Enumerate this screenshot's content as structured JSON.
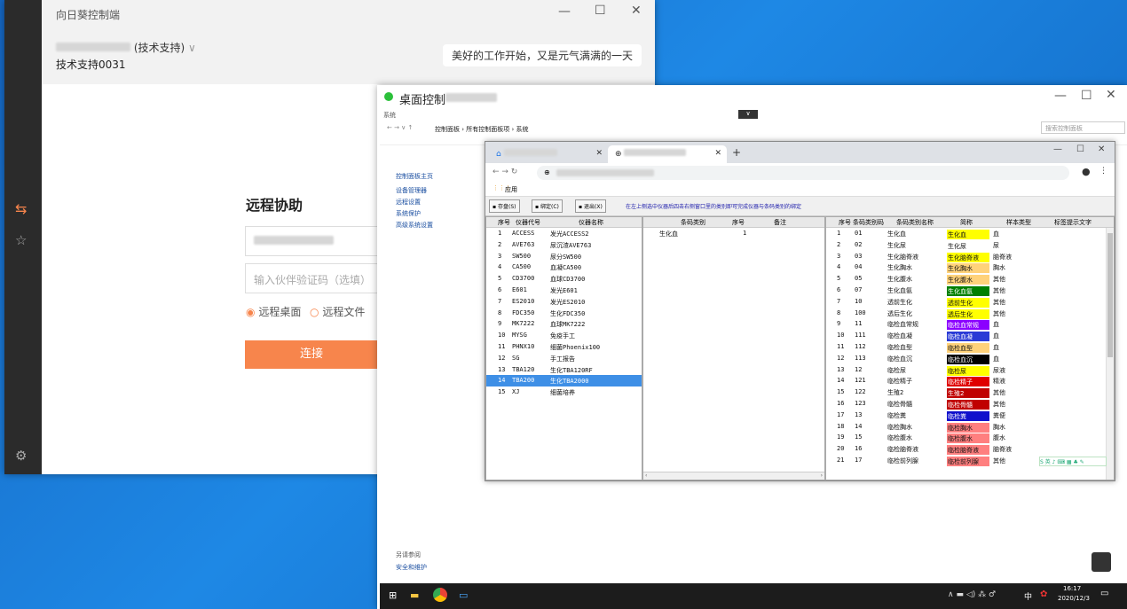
{
  "sunflower": {
    "title": "向日葵控制端",
    "user_role": "(技术支持)",
    "user_name": "技术支持0031",
    "greeting": "美好的工作开始，又是元气满满的一天",
    "heading": "远程协助",
    "code_placeholder": "输入伙伴验证码（选填）",
    "radio_desktop": "远程桌面",
    "radio_file": "远程文件",
    "connect_label": "连接"
  },
  "remote": {
    "title": "桌面控制",
    "cp_breadcrumb": "控制面板 › 所有控制面板项 › 系统",
    "cp_search": "搜索控制面板",
    "cp_window_label": "系统",
    "cp_home": "控制面板主页",
    "cp_links": [
      "设备管理器",
      "远程设置",
      "系统保护",
      "高级系统设置"
    ],
    "cp_see_also": "另请参阅",
    "cp_security": "安全和维护",
    "clock_time": "16:17",
    "clock_date": "2020/12/3",
    "ime": "中"
  },
  "chrome": {
    "bookmark": "应用",
    "toolbar": {
      "save": "存盘(S)",
      "bind": "绑定(C)",
      "exit": "退出(X)",
      "hint": "在左上侧选中仪器后四击右侧窗口里的类别即可完成仪器与条码类别的绑定"
    },
    "instruments_headers": [
      "序号",
      "仪器代号",
      "仪器名称"
    ],
    "instruments": [
      [
        "1",
        "ACCESS",
        "发光ACCESS2"
      ],
      [
        "2",
        "AVE763",
        "尿沉渣AVE763"
      ],
      [
        "3",
        "SW500",
        "尿分SW500"
      ],
      [
        "4",
        "CA500",
        "血凝CA500"
      ],
      [
        "5",
        "CD3700",
        "血球CD3700"
      ],
      [
        "6",
        "E601",
        "发光E601"
      ],
      [
        "7",
        "ES2010",
        "发光ES2010"
      ],
      [
        "8",
        "FDC350",
        "生化FDC350"
      ],
      [
        "9",
        "MK7222",
        "血球MK7222"
      ],
      [
        "10",
        "MYSG",
        "免疫手工"
      ],
      [
        "11",
        "PHNX10",
        "细菌Phoenix100"
      ],
      [
        "12",
        "SG",
        "手工报告"
      ],
      [
        "13",
        "TBA120",
        "生化TBA120RF"
      ],
      [
        "14",
        "TBA200",
        "生化TBA2000"
      ],
      [
        "15",
        "XJ",
        "细菌培养"
      ]
    ],
    "mid_headers": [
      "条码类别",
      "序号",
      "备注"
    ],
    "mid_rows": [
      [
        "生化血",
        "1",
        ""
      ]
    ],
    "right_headers": [
      "序号",
      "条码类别码",
      "条码类别名称",
      "简称",
      "样本类型",
      "标签提示文字"
    ],
    "right_rows": [
      [
        "1",
        "01",
        "生化血",
        "生化血",
        "血",
        "#ffff00"
      ],
      [
        "2",
        "02",
        "生化尿",
        "生化尿",
        "尿",
        "#ffffff"
      ],
      [
        "3",
        "03",
        "生化脑脊液",
        "生化脑脊液",
        "脑脊液",
        "#ffff00"
      ],
      [
        "4",
        "04",
        "生化胸水",
        "生化胸水",
        "胸水",
        "#ffd27a"
      ],
      [
        "5",
        "05",
        "生化腹水",
        "生化腹水",
        "其他",
        "#ffd27a"
      ],
      [
        "6",
        "07",
        "生化血氨",
        "生化血氨",
        "其他",
        "#008000"
      ],
      [
        "7",
        "10",
        "透前生化",
        "透前生化",
        "其他",
        "#ffff00"
      ],
      [
        "8",
        "100",
        "透后生化",
        "透后生化",
        "其他",
        "#ffff00"
      ],
      [
        "9",
        "11",
        "临检血常规",
        "临检血常规",
        "血",
        "#8b00ff"
      ],
      [
        "10",
        "111",
        "临检血凝",
        "临检血凝",
        "血",
        "#2b3bd6"
      ],
      [
        "11",
        "112",
        "临检血型",
        "临检血型",
        "血",
        "#ffd27a"
      ],
      [
        "12",
        "113",
        "临检血沉",
        "临检血沉",
        "血",
        "#000000"
      ],
      [
        "13",
        "12",
        "临检尿",
        "临检尿",
        "尿液",
        "#ffff00"
      ],
      [
        "14",
        "121",
        "临检精子",
        "临检精子",
        "精液",
        "#e00000"
      ],
      [
        "15",
        "122",
        "生殖2",
        "生殖2",
        "其他",
        "#c00000"
      ],
      [
        "16",
        "123",
        "临检骨髓",
        "临检骨髓",
        "其他",
        "#c00000"
      ],
      [
        "17",
        "13",
        "临检粪",
        "临检粪",
        "粪便",
        "#1111cc"
      ],
      [
        "18",
        "14",
        "临检胸水",
        "临检胸水",
        "胸水",
        "#ff7f7f"
      ],
      [
        "19",
        "15",
        "临检腹水",
        "临检腹水",
        "腹水",
        "#ff7f7f"
      ],
      [
        "20",
        "16",
        "临检脑脊液",
        "临检脑脊液",
        "脑脊液",
        "#ff7f7f"
      ],
      [
        "21",
        "17",
        "临检前列腺",
        "临检前列腺",
        "其他",
        "#ff7f7f"
      ]
    ]
  }
}
